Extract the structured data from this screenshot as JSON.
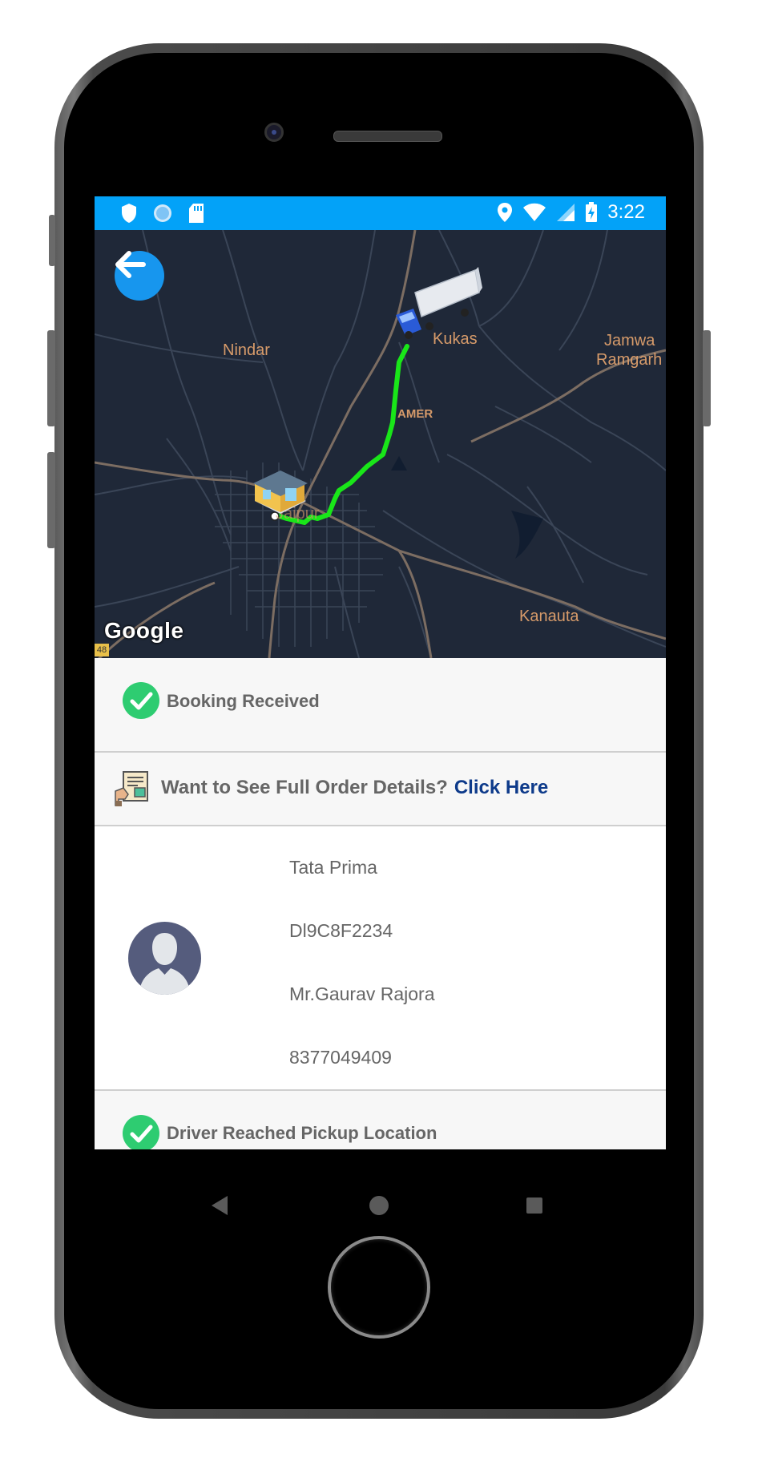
{
  "status_bar": {
    "time": "3:22",
    "left_icons": [
      "shield-icon",
      "circle-icon",
      "sd-card-icon"
    ],
    "right_icons": [
      "location-pin-icon",
      "wifi-icon",
      "signal-icon",
      "battery-charging-icon"
    ]
  },
  "map": {
    "place_labels": {
      "nindar": "Nindar",
      "kukas": "Kukas",
      "jamwa_line1": "Jamwa",
      "jamwa_line2": "Ramgarh",
      "amer": "AMER",
      "jaipur": "Jaipur",
      "kanauta": "Kanauta"
    },
    "attribution": "Google",
    "road_badge": "48",
    "route_color": "#19e619",
    "background_color": "#1f2838"
  },
  "timeline": {
    "booking_received": "Booking Received",
    "order_prompt": "Want to See Full Order Details?",
    "order_link": "Click Here",
    "driver": {
      "vehicle": "Tata Prima",
      "vehicle_number": "Dl9C8F2234",
      "name": "Mr.Gaurav Rajora",
      "phone": "8377049409"
    },
    "driver_reached": "Driver Reached Pickup Location"
  },
  "colors": {
    "accent": "#03a2f8",
    "success": "#2ecc71",
    "link": "#0d3a8a"
  },
  "nav_bar": {
    "icons": [
      "back-triangle-icon",
      "home-circle-icon",
      "recents-square-icon"
    ]
  }
}
